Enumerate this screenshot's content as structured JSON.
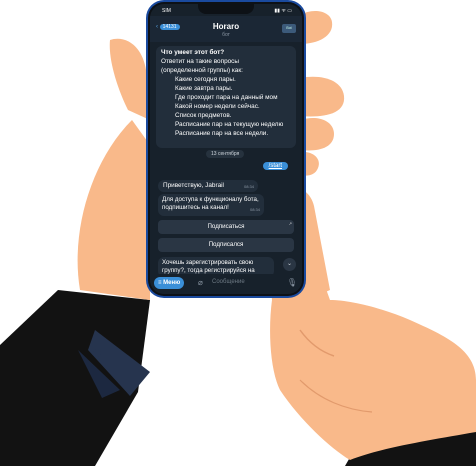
{
  "status": {
    "time": "SIM",
    "icons": "▮▮ ᯤ ▭"
  },
  "header": {
    "back_badge": "14131",
    "title": "Horaro",
    "subtitle": "бот",
    "avatar_text": "Bot"
  },
  "messages": {
    "intro": {
      "question": "Что умеет этот бот?",
      "lead1": "Ответит на такие вопросы",
      "lead2": "(определенной группы) как:",
      "items": [
        "Какие сегодня пары.",
        "Какие завтра пары.",
        "Где проходит пара на данный мом",
        "Какой номер недели сейчас.",
        "Список предметов.",
        "Расписание пар на текущую неделю",
        "Расписание пар на все недели."
      ]
    },
    "date_chip": "13 сентября",
    "outgoing": "/start",
    "greeting": {
      "text": "Приветствую, Jabrail",
      "time": "08:34"
    },
    "access": {
      "line1": "Для доступа к функционалу бота,",
      "line2": "подпишитесь на канал!",
      "time": "08:34"
    },
    "buttons": {
      "subscribe": "Подписаться",
      "subscribed": "Подписался"
    },
    "register": {
      "line1": "Хочешь зарегистрировать свою",
      "line2": "группу?, тогда регистрируйся на"
    }
  },
  "input": {
    "menu_label": "≡ Меню",
    "placeholder": "Сообщение"
  },
  "colors": {
    "screen_bg": "#17212b",
    "bubble": "#222e3b",
    "accent": "#3a8fd8",
    "skin": "#f9b98a",
    "sleeve": "#111111"
  }
}
